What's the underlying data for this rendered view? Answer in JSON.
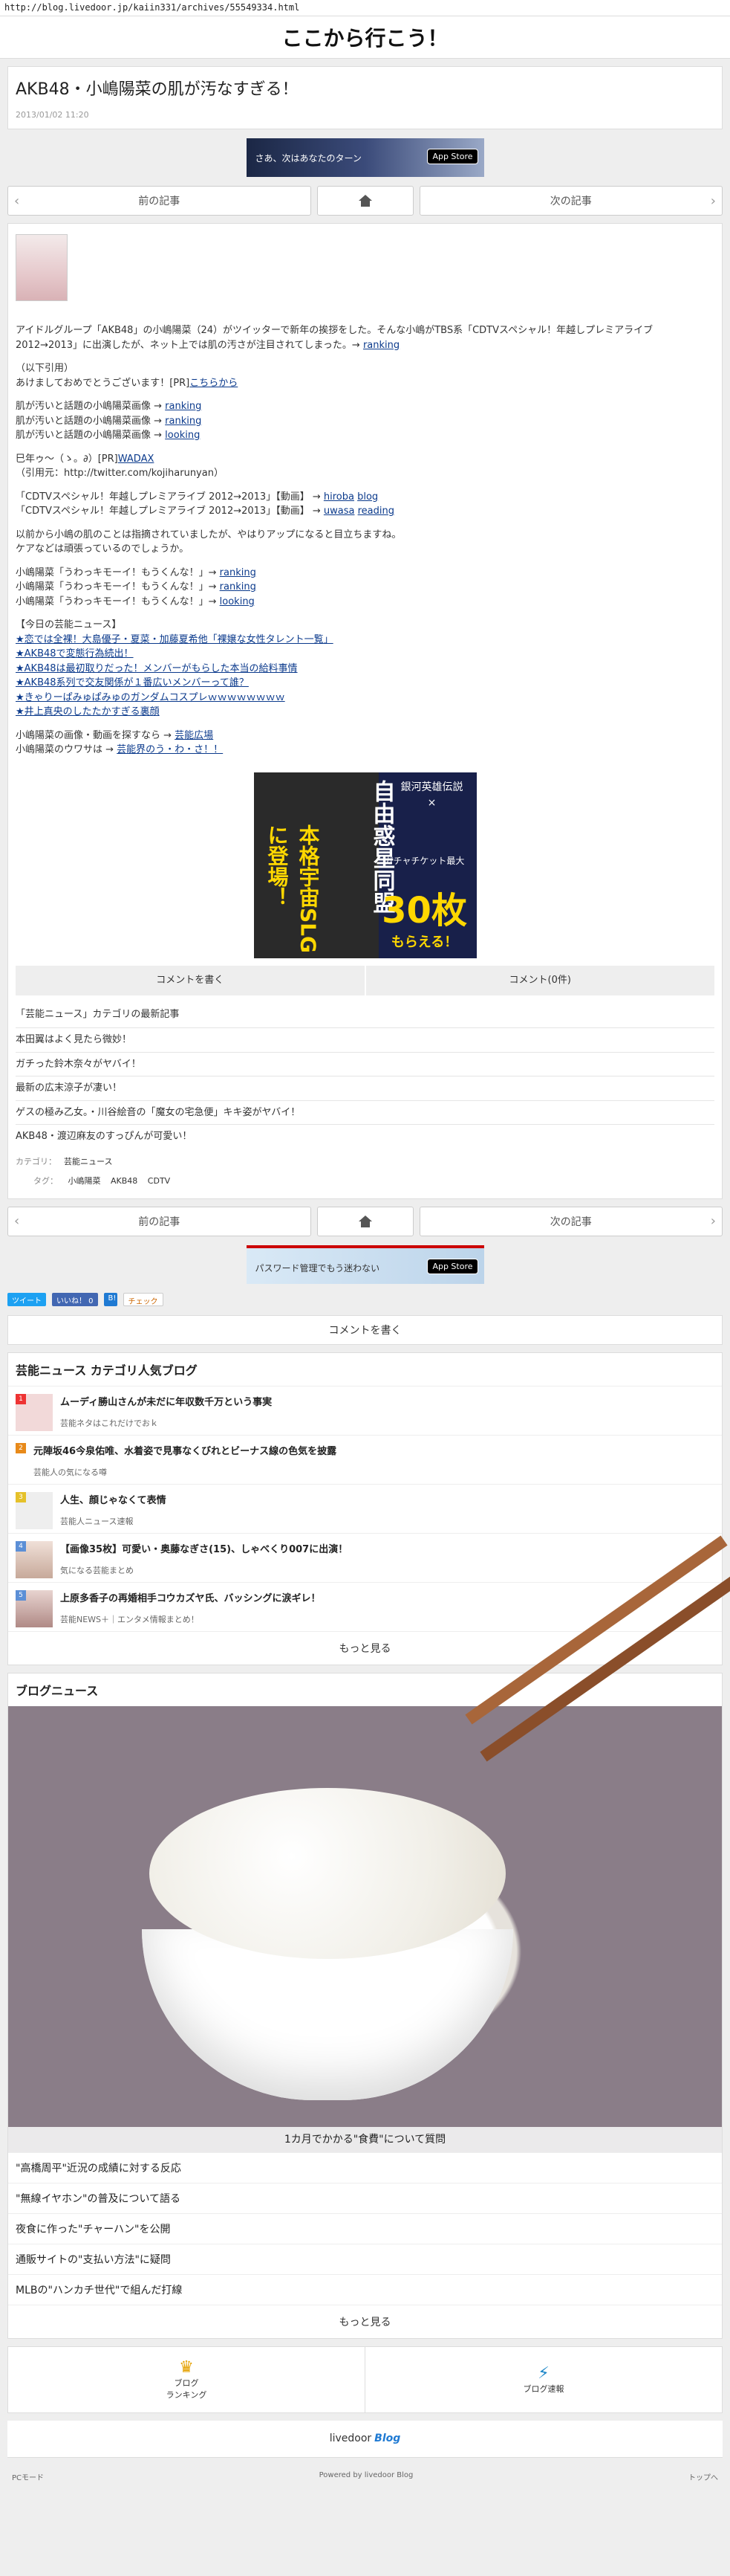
{
  "url": "http://blog.livedoor.jp/kaiin331/archives/55549334.html",
  "site_title": "ここから行こう！",
  "post": {
    "title": "AKB48・小嶋陽菜の肌が汚なすぎる！",
    "date": "2013/01/02 11:20"
  },
  "ad_top": {
    "text": "さあ、次はあなたのターン",
    "store": "App Store"
  },
  "pager": {
    "prev": "前の記事",
    "next": "次の記事"
  },
  "article": {
    "lines": [
      "アイドルグループ「AKB48」の小嶋陽菜（24）がツイッターで新年の挨拶をした。そんな小嶋がTBS系「CDTVスペシャル！年越しプレミアライブ2012→2013」に出演したが、ネット上では肌の汚さが注目されてしまった。→",
      "（以下引用）",
      "あけましておめでとうございます！[PR]",
      "肌が汚いと話題の小嶋陽菜画像 →",
      "肌が汚いと話題の小嶋陽菜画像 →",
      "肌が汚いと話題の小嶋陽菜画像 →",
      "巳年ゥ〜（ゝ。∂）[PR]",
      "（引用元：http://twitter.com/kojiharunyan）",
      "「CDTVスペシャル！年越しプレミアライブ 2012→2013」【動画】 →",
      "「CDTVスペシャル！年越しプレミアライブ 2012→2013」【動画】 →",
      "以前から小嶋の肌のことは指摘されていましたが、やはりアップになると目立ちますね。",
      "ケアなどは頑張っているのでしょうか。",
      "小嶋陽菜「うわっキモーイ！もうくんな！」→",
      "小嶋陽菜「うわっキモーイ！もうくんな！」→",
      "小嶋陽菜「うわっキモーイ！もうくんな！」→",
      "【今日の芸能ニュース】",
      "小嶋陽菜の画像・動画を探すなら →",
      "小嶋陽菜のウワサは →"
    ],
    "links": {
      "ranking": "ranking",
      "looking": "looking",
      "kochira": "こちらから",
      "wadax": "WADAX",
      "hiroba": "hiroba",
      "blog": "blog",
      "uwasa": "uwasa",
      "reading": "reading",
      "geinou_hiroba": "芸能広場",
      "geinou_uwasa": "芸能界のう・わ・さ！！"
    },
    "news": [
      "★恋では全裸！大島優子・夏菜・加藤夏希他「裸嬢な女性タレント一覧」",
      "★AKB48で変態行為続出！",
      "★AKB48は最初取りだった！メンバーがもらした本当の給料事情",
      "★AKB48系列で交友関係が１番広いメンバーって誰？",
      "★きゃりーぱみゅぱみゅのガンダムコスプレｗｗｗｗｗｗｗｗ",
      "★井上真央のしたたかすぎる裏顔"
    ]
  },
  "big_ad": {
    "left": "本格宇宙SLGに登場！",
    "middle": "自由惑星同盟",
    "top": "銀河英雄伝説 ×",
    "mid": "ガチャチケット最大",
    "count": "30枚",
    "bottom": "もらえる！"
  },
  "comments": {
    "write": "コメントを書く",
    "count": "コメント(0件)"
  },
  "category": {
    "title": "「芸能ニュース」カテゴリの最新記事",
    "items": [
      "本田翼はよく見たら微妙！",
      "ガチった鈴木奈々がヤバイ！",
      "最新の広末涼子が凄い！",
      "ゲスの極み乙女。・川谷絵音の「魔女の宅急便」キキ姿がヤバイ！",
      "AKB48・渡辺麻友のすっぴんが可愛い！"
    ]
  },
  "meta": {
    "category_label": "カテゴリ：",
    "category": "芸能ニュース",
    "tags_label": "タグ：",
    "tags": [
      "小嶋陽菜",
      "AKB48",
      "CDTV"
    ]
  },
  "ad_bottom": {
    "text": "パスワード管理でもう迷わない",
    "store": "App Store"
  },
  "social": {
    "tweet": "ツイート",
    "like": "いいね！ 0",
    "hatena": "B!",
    "check": "チェック"
  },
  "comment_write": "コメントを書く",
  "popular": {
    "title": "芸能ニュース カテゴリ人気ブログ",
    "items": [
      {
        "num": "1",
        "title": "ムーディ勝山さんが未だに年収数千万という事実",
        "source": "芸能ネタはこれだけでおｋ"
      },
      {
        "num": "2",
        "title": "元陣坂46今泉佑唯、水着姿で見事なくびれとビーナス線の色気を披露",
        "source": "芸能人の気になる噂"
      },
      {
        "num": "3",
        "title": "人生、顔じゃなくて表情",
        "source": "芸能人ニュース速報"
      },
      {
        "num": "4",
        "title": "【画像35枚】可愛い・奥藤なぎさ(15)、しゃべくり007に出演！",
        "source": "気になる芸能まとめ"
      },
      {
        "num": "5",
        "title": "上原多香子の再婚相手コウカズヤ氏、バッシングに涙ギレ！",
        "source": "芸能NEWS＋｜エンタメ情報まとめ！"
      }
    ],
    "more": "もっと見る"
  },
  "blog_news": {
    "title": "ブログニュース",
    "caption": "1カ月でかかる\"食費\"について質問",
    "items": [
      "\"高橋周平\"近況の成績に対する反応",
      "\"無線イヤホン\"の普及について語る",
      "夜食に作った\"チャーハン\"を公開",
      "通販サイトの\"支払い方法\"に疑問",
      "MLBの\"ハンカチ世代\"で組んだ打線"
    ],
    "more": "もっと見る"
  },
  "footer_nav": {
    "ranking": "ブログ\nランキング",
    "quick": "ブログ速報"
  },
  "brand": {
    "name": "livedoor",
    "blog": "Blog"
  },
  "bottom": {
    "pc": "PCモード",
    "powered": "Powered by livedoor Blog",
    "top": "トップへ"
  }
}
